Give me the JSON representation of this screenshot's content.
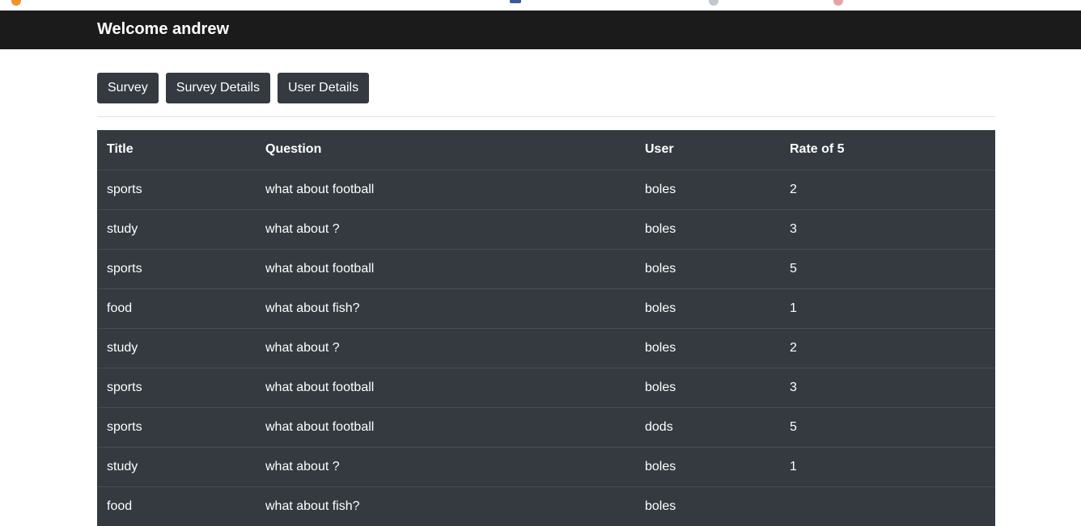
{
  "navbar": {
    "welcome_text": "Welcome andrew"
  },
  "buttons": {
    "survey": "Survey",
    "survey_details": "Survey Details",
    "user_details": "User Details"
  },
  "table": {
    "headers": {
      "title": "Title",
      "question": "Question",
      "user": "User",
      "rate": "Rate of 5"
    },
    "rows": [
      {
        "title": "sports",
        "question": "what about football",
        "user": "boles",
        "rate": "2"
      },
      {
        "title": "study",
        "question": "what about ?",
        "user": "boles",
        "rate": "3"
      },
      {
        "title": "sports",
        "question": "what about football",
        "user": "boles",
        "rate": "5"
      },
      {
        "title": "food",
        "question": "what about fish?",
        "user": "boles",
        "rate": "1"
      },
      {
        "title": "study",
        "question": "what about ?",
        "user": "boles",
        "rate": "2"
      },
      {
        "title": "sports",
        "question": "what about football",
        "user": "boles",
        "rate": "3"
      },
      {
        "title": "sports",
        "question": "what about football",
        "user": "dods",
        "rate": "5"
      },
      {
        "title": "study",
        "question": "what about ?",
        "user": "boles",
        "rate": "1"
      },
      {
        "title": "food",
        "question": "what about fish?",
        "user": "boles",
        "rate": ""
      }
    ]
  },
  "colors": {
    "navbar_bg": "#1b1b1b",
    "table_bg": "#343a40",
    "button_bg": "#343a40",
    "row_border": "#454d55"
  }
}
